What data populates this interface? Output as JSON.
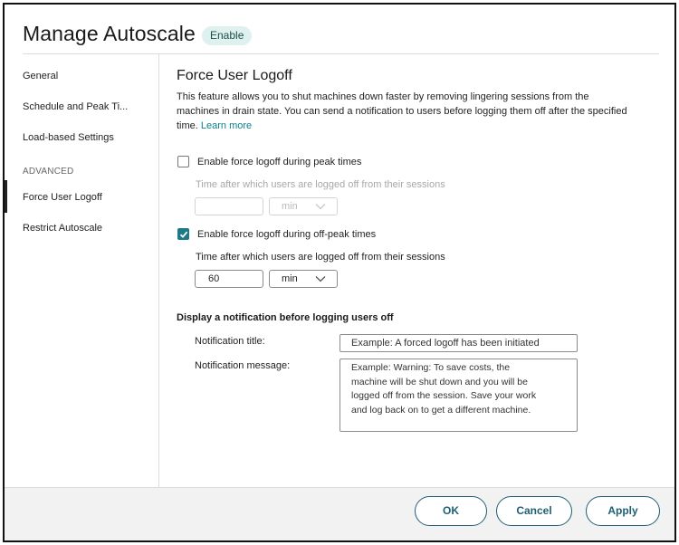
{
  "header": {
    "title": "Manage Autoscale",
    "badge": "Enable"
  },
  "sidebar": {
    "items": [
      {
        "label": "General"
      },
      {
        "label": "Schedule and Peak Ti..."
      },
      {
        "label": "Load-based Settings"
      }
    ],
    "section_label": "ADVANCED",
    "advanced_items": [
      {
        "label": "Force User Logoff",
        "active": true
      },
      {
        "label": "Restrict Autoscale"
      }
    ]
  },
  "main": {
    "heading": "Force User Logoff",
    "description": "This feature allows you to shut machines down faster by removing lingering sessions from the machines in drain state. You can send a notification to users before logging them off after the specified time.",
    "learn_more": "Learn more",
    "peak": {
      "checkbox_label": "Enable force logoff during peak times",
      "checked": false,
      "time_label": "Time after which users are logged off from their sessions",
      "value": "",
      "unit": "min"
    },
    "offpeak": {
      "checkbox_label": "Enable force logoff during off-peak times",
      "checked": true,
      "time_label": "Time after which users are logged off from their sessions",
      "value": "60",
      "unit": "min"
    },
    "notification": {
      "section_title": "Display a notification before logging users off",
      "title_label": "Notification title:",
      "title_placeholder": "Example: A forced logoff has been initiated",
      "message_label": "Notification message:",
      "message_placeholder": "Example: Warning: To save costs, the\nmachine will be shut down and you will be\nlogged off from the session. Save your work\nand log back on to get a different machine."
    }
  },
  "footer": {
    "ok_label": "OK",
    "cancel_label": "Cancel",
    "apply_label": "Apply"
  },
  "colors": {
    "accent": "#1d7a86",
    "button_border": "#1f5f73",
    "badge_bg": "#dff1ee",
    "link": "#0b7f8f"
  }
}
